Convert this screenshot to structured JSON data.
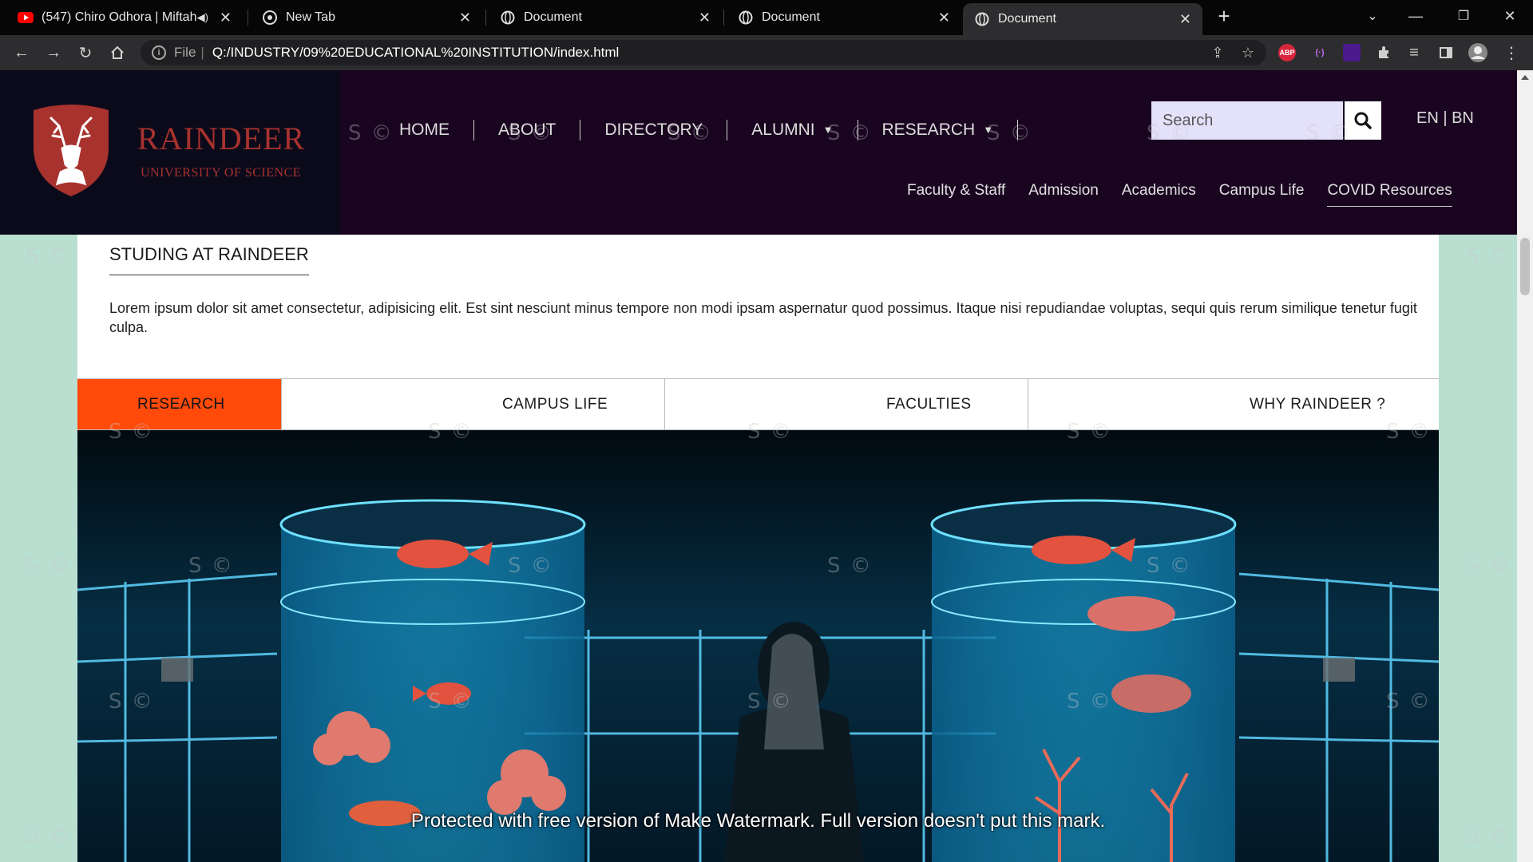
{
  "browser": {
    "tabs": [
      {
        "title": "(547) Chiro Odhora | Miftah",
        "favicon": "youtube-icon",
        "audio": true
      },
      {
        "title": "New Tab",
        "favicon": "chrome-icon"
      },
      {
        "title": "Document",
        "favicon": "globe-icon"
      },
      {
        "title": "Document",
        "favicon": "globe-icon"
      },
      {
        "title": "Document",
        "favicon": "globe-icon",
        "active": true
      }
    ],
    "address": {
      "scheme": "File",
      "url": "Q:/INDUSTRY/09%20EDUCATIONAL%20INSTITUTION/index.html"
    },
    "extensions": [
      "ABP",
      "(·)"
    ]
  },
  "header": {
    "brand_name": "RAINDEER",
    "brand_sub": "UNIVERSITY OF SCIENCE",
    "nav": [
      {
        "label": "HOME"
      },
      {
        "label": "ABOUT"
      },
      {
        "label": "DIRECTORY"
      },
      {
        "label": "ALUMNI",
        "caret": "▼"
      },
      {
        "label": "RESEARCH",
        "caret": "▼"
      }
    ],
    "search_placeholder": "Search",
    "lang": "EN | BN",
    "subnav": [
      "Faculty & Staff",
      "Admission",
      "Academics",
      "Campus Life",
      "COVID Resources"
    ]
  },
  "intro": {
    "title": "STUDING AT RAINDEER",
    "text": "Lorem ipsum dolor sit amet consectetur, adipisicing elit. Est sint nesciunt minus tempore non modi ipsam aspernatur quod possimus. Itaque nisi repudiandae voluptas, sequi quis rerum similique tenetur fugit culpa."
  },
  "tabs": [
    "RESEARCH",
    "CAMPUS LIFE",
    "FACULTIES",
    "WHY RAINDEER ?"
  ],
  "hero": {
    "caption": "Protected with free version of Make Watermark. Full version doesn't put this mark."
  },
  "watermark": "S ©",
  "colors": {
    "header_bg": "#1a0521",
    "brand": "#a8322e",
    "tab_active": "#ff4a0a",
    "page_bg": "#b9dfd1"
  }
}
